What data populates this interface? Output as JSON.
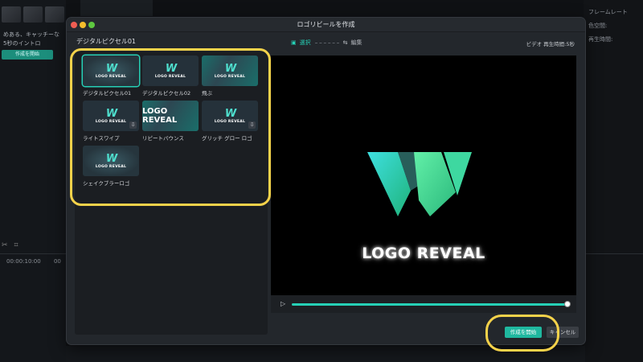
{
  "background": {
    "promo_text_1": "めある、キャッチーな",
    "promo_text_2": "5秒のイントロ",
    "promo_button": "作成を開始",
    "timecode": "00:00:10:00",
    "timecode2": "00",
    "right_labels": [
      "フレームレート",
      "色空間:",
      "再生時間:"
    ]
  },
  "dialog": {
    "title": "ロゴリビールを作成",
    "left_header": "デジタルピクセル01",
    "templates": [
      {
        "label": "デジタルピクセル01",
        "style": "selected",
        "download": false
      },
      {
        "label": "デジタルピクセル02",
        "style": "dark",
        "download": false
      },
      {
        "label": "飛ぶ",
        "style": "teal",
        "download": false
      },
      {
        "label": "ライトスワイプ",
        "style": "dark",
        "download": true
      },
      {
        "label": "リピートバウンス",
        "style": "big",
        "download": false
      },
      {
        "label": "グリッチ グロー ロゴ",
        "style": "dark",
        "download": true
      },
      {
        "label": "シェイクブラーロゴ",
        "style": "glow",
        "download": false
      }
    ],
    "thumb_text": "LOGO REVEAL",
    "steps": {
      "select": "選択",
      "edit": "編集"
    },
    "duration": "ビデオ 再生時間:5秒",
    "preview_text": "LOGO REVEAL",
    "progress": 1.0,
    "create_button": "作成を開始",
    "cancel_button": "キャンセル"
  },
  "colors": {
    "accent": "#26d0b6",
    "highlight": "#f4d24a"
  }
}
